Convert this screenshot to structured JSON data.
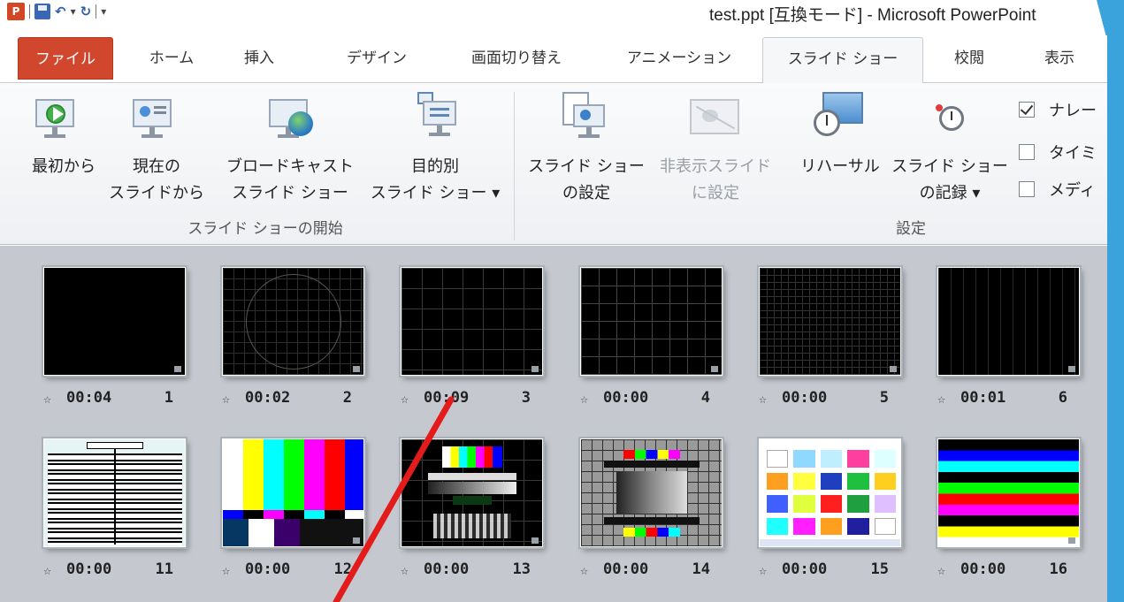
{
  "window": {
    "title": "test.ppt [互換モード] - Microsoft PowerPoint",
    "qat": {
      "app_icon": "P"
    }
  },
  "tabs": [
    {
      "label": "ファイル"
    },
    {
      "label": "ホーム"
    },
    {
      "label": "挿入"
    },
    {
      "label": "デザイン"
    },
    {
      "label": "画面切り替え"
    },
    {
      "label": "アニメーション"
    },
    {
      "label": "スライド ショー"
    },
    {
      "label": "校閲"
    },
    {
      "label": "表示"
    }
  ],
  "ribbon": {
    "start_group": {
      "label": "スライド ショーの開始",
      "from_beginning": "最初から",
      "from_current_l1": "現在の",
      "from_current_l2": "スライドから",
      "broadcast_l1": "ブロードキャスト",
      "broadcast_l2": "スライド ショー",
      "custom_l1": "目的別",
      "custom_l2": "スライド ショー ▾"
    },
    "setup_group": {
      "label": "設定",
      "setup_l1": "スライド ショー",
      "setup_l2": "の設定",
      "hide_l1": "非表示スライド",
      "hide_l2": "に設定",
      "rehearse": "リハーサル",
      "record_l1": "スライド ショー",
      "record_l2": "の記録 ▾"
    },
    "checkboxes": [
      {
        "label": "ナレー",
        "checked": true
      },
      {
        "label": "タイミ",
        "checked": false
      },
      {
        "label": "メディ",
        "checked": false
      }
    ]
  },
  "slides": [
    {
      "time": "00:04",
      "num": "1"
    },
    {
      "time": "00:02",
      "num": "2"
    },
    {
      "time": "00:09",
      "num": "3"
    },
    {
      "time": "00:00",
      "num": "4"
    },
    {
      "time": "00:00",
      "num": "5"
    },
    {
      "time": "00:01",
      "num": "6"
    },
    {
      "time": "00:00",
      "num": "11"
    },
    {
      "time": "00:00",
      "num": "12"
    },
    {
      "time": "00:00",
      "num": "13"
    },
    {
      "time": "00:00",
      "num": "14"
    },
    {
      "time": "00:00",
      "num": "15"
    },
    {
      "time": "00:00",
      "num": "16"
    }
  ],
  "colors": {
    "file_tab": "#d1472d",
    "annotation": "#e41b1b",
    "accent_bar": "#3aa3dc"
  }
}
